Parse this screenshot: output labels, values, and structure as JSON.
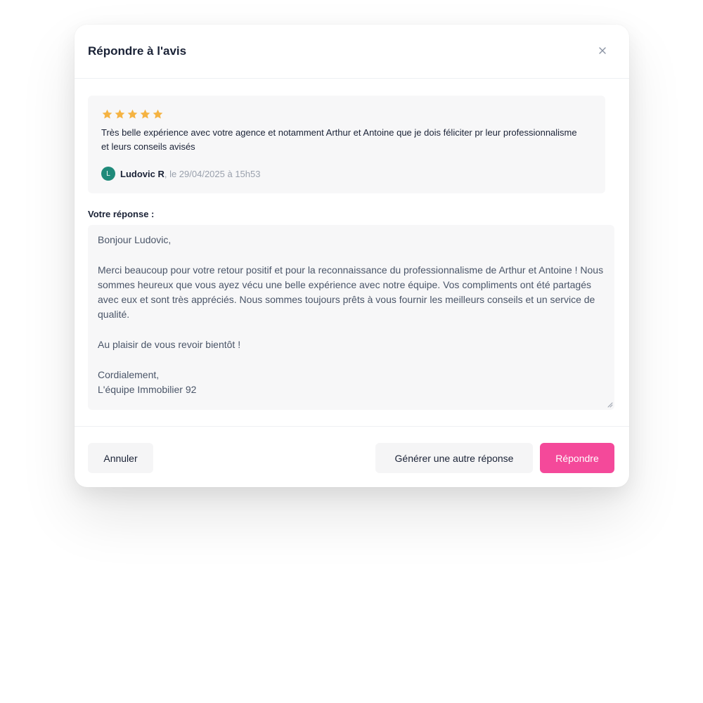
{
  "modal": {
    "title": "Répondre à l'avis"
  },
  "review": {
    "rating": 5,
    "star_color": "#f5b342",
    "text": "Très belle expérience avec votre agence et notamment Arthur et Antoine que je dois féliciter pr leur professionnalisme et leurs conseils avisés",
    "author_initial": "L",
    "author_name": "Ludovic R",
    "date": ", le 29/04/2025 à 15h53",
    "avatar_color": "#1f8a7a"
  },
  "response": {
    "label": "Votre réponse :",
    "value": "Bonjour Ludovic,\n\nMerci beaucoup pour votre retour positif et pour la reconnaissance du professionnalisme de Arthur et Antoine ! Nous sommes heureux que vous ayez vécu une belle expérience avec notre équipe. Vos compliments ont été partagés avec eux et sont très appréciés. Nous sommes toujours prêts à vous fournir les meilleurs conseils et un service de qualité.\n\nAu plaisir de vous revoir bientôt !\n\nCordialement,\nL'équipe Immobilier 92"
  },
  "footer": {
    "cancel_label": "Annuler",
    "regenerate_label": "Générer une autre réponse",
    "reply_label": "Répondre"
  },
  "colors": {
    "accent": "#f4499a",
    "text_primary": "#1a2236",
    "text_muted": "#9aa1ad",
    "surface": "#f7f7f8"
  },
  "icons": {
    "close": "close-icon",
    "star": "star-icon",
    "resize": "resize-handle-icon"
  }
}
